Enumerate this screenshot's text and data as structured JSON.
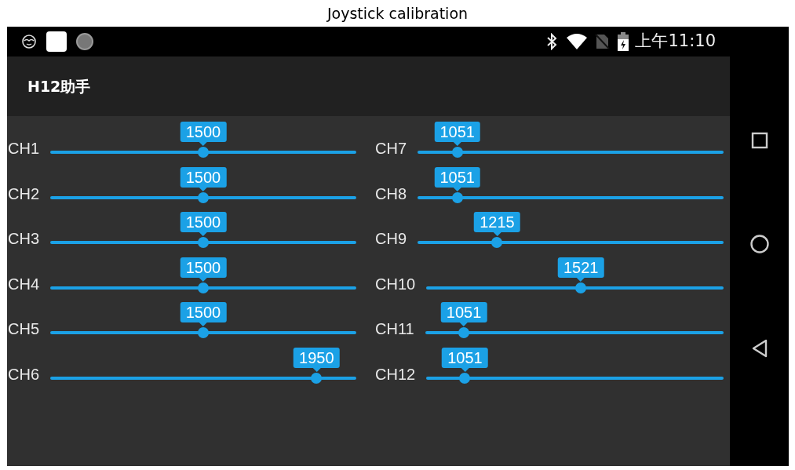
{
  "caption": "Joystick calibration",
  "status_bar": {
    "time": "上午11:10"
  },
  "app_bar": {
    "title": "H12助手"
  },
  "left_column": [
    {
      "label": "CH1",
      "value": "1500",
      "level": 0.5
    },
    {
      "label": "CH2",
      "value": "1500",
      "level": 0.5
    },
    {
      "label": "CH3",
      "value": "1500",
      "level": 0.5
    },
    {
      "label": "CH4",
      "value": "1500",
      "level": 0.5
    },
    {
      "label": "CH5",
      "value": "1500",
      "level": 0.5
    },
    {
      "label": "CH6",
      "value": "1950",
      "level": 0.87
    }
  ],
  "right_column": [
    {
      "label": "CH7",
      "value": "1051",
      "level": 0.13
    },
    {
      "label": "CH8",
      "value": "1051",
      "level": 0.13
    },
    {
      "label": "CH9",
      "value": "1215",
      "level": 0.26
    },
    {
      "label": "CH10",
      "value": "1521",
      "level": 0.52
    },
    {
      "label": "CH11",
      "value": "1051",
      "level": 0.13
    },
    {
      "label": "CH12",
      "value": "1051",
      "level": 0.13
    }
  ]
}
